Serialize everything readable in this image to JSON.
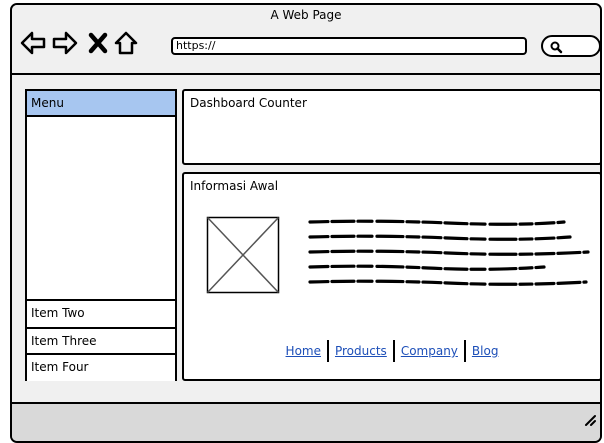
{
  "window": {
    "title": "A Web Page"
  },
  "toolbar": {
    "url_value": "https://",
    "icons": [
      "back-arrow-icon",
      "forward-arrow-icon",
      "close-x-icon",
      "home-icon",
      "search-icon"
    ]
  },
  "sidebar": {
    "header": "Menu",
    "items": [
      {
        "label": "Item Two"
      },
      {
        "label": "Item Three"
      },
      {
        "label": "Item Four"
      }
    ]
  },
  "main": {
    "counter_panel": {
      "title": "Dashboard Counter"
    },
    "info_panel": {
      "title": "Informasi Awal"
    },
    "footer_links": [
      {
        "label": "Home"
      },
      {
        "label": "Products"
      },
      {
        "label": "Company"
      },
      {
        "label": "Blog"
      }
    ]
  },
  "colors": {
    "menu_header_bg": "#a7c6f0",
    "link": "#1d4fb8",
    "chrome": "#f0f0f0"
  }
}
